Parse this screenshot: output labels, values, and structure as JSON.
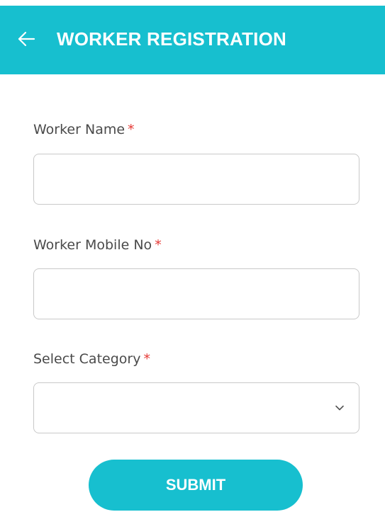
{
  "header": {
    "title": "WORKER REGISTRATION",
    "back_icon": "arrow-left-icon",
    "background_color": "#17bfcf"
  },
  "form": {
    "required_marker": "*",
    "worker_name": {
      "label": "Worker Name",
      "value": "",
      "placeholder": ""
    },
    "worker_mobile": {
      "label": "Worker Mobile No",
      "value": "",
      "placeholder": ""
    },
    "category": {
      "label": "Select Category",
      "selected": "",
      "icon": "chevron-down-icon"
    },
    "submit_label": "SUBMIT"
  },
  "colors": {
    "accent": "#17bfcf",
    "required": "#e53935",
    "label_text": "#4a4a4a",
    "field_border": "#c9c9c9"
  }
}
